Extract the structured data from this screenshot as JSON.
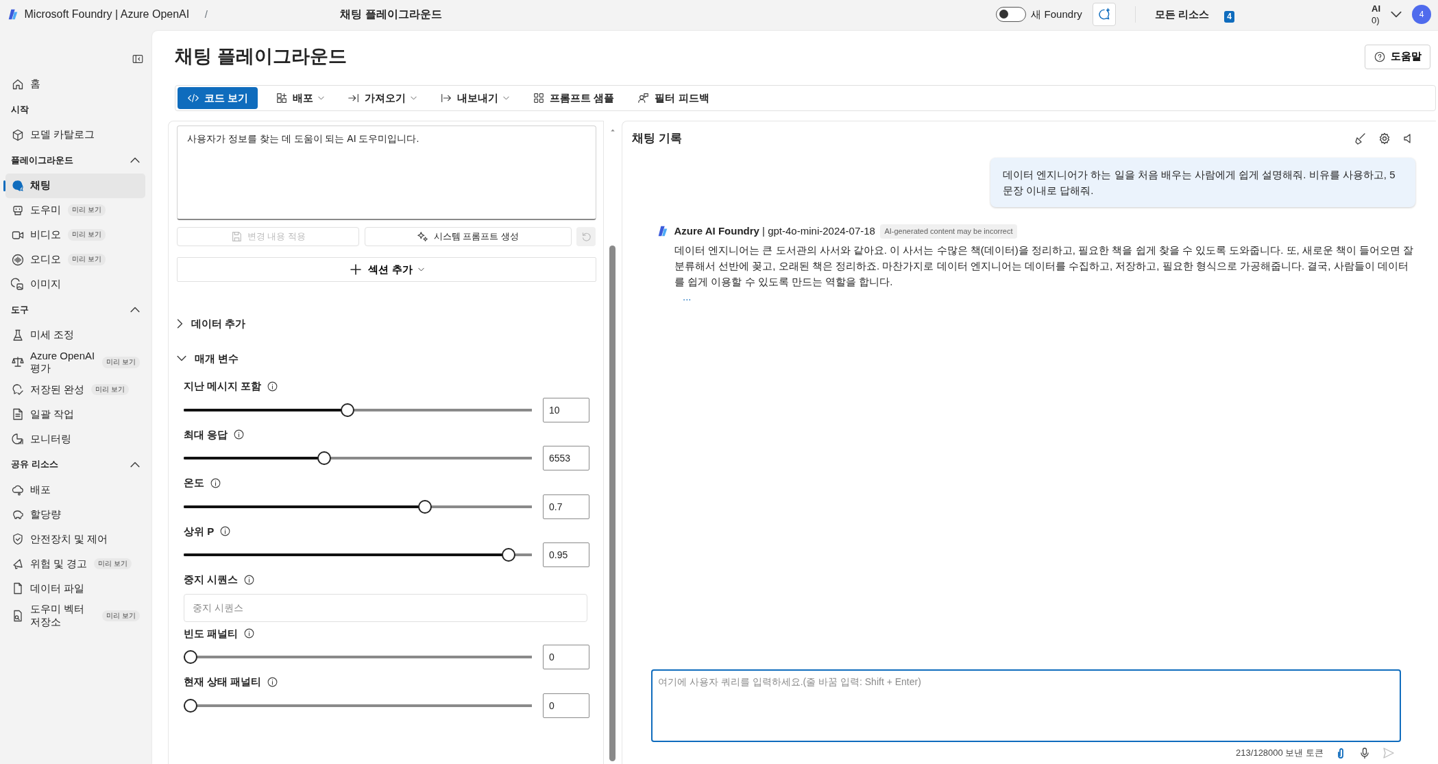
{
  "top_bar": {
    "brand": "Microsoft Foundry | Azure OpenAI",
    "separator": "/",
    "page": "채팅 플레이그라운드",
    "toggle": {
      "label": "새 Foundry",
      "on": false
    },
    "resources": "모든 리소스",
    "resources_badge": "4",
    "account_line_1": "AI",
    "account_line_2": "0)",
    "avatar": "4"
  },
  "sidebar": {
    "top_items": [
      {
        "label": "홈",
        "selected": false
      }
    ],
    "sections": [
      {
        "title": "시작",
        "items": [
          {
            "label": "모델 카탈로그",
            "selected": false
          }
        ]
      },
      {
        "title": "플레이그라운드",
        "expanded": true,
        "items": [
          {
            "label": "채팅",
            "selected": true
          },
          {
            "label": "도우미",
            "selected": false,
            "badge": "미리 보기"
          },
          {
            "label": "비디오",
            "selected": false,
            "badge": "미리 보기"
          },
          {
            "label": "오디오",
            "selected": false,
            "badge": "미리 보기"
          },
          {
            "label": "이미지",
            "selected": false
          }
        ]
      },
      {
        "title": "도구",
        "expanded": true,
        "items": [
          {
            "label": "미세 조정",
            "selected": false
          },
          {
            "label": "Azure OpenAI 평가",
            "selected": false,
            "badge": "미리 보기"
          },
          {
            "label": "저장된 완성",
            "selected": false,
            "badge": "미리 보기"
          },
          {
            "label": "일괄 작업",
            "selected": false
          },
          {
            "label": "모니터링",
            "selected": false
          }
        ]
      },
      {
        "title": "공유 리소스",
        "expanded": true,
        "items": [
          {
            "label": "배포",
            "selected": false
          },
          {
            "label": "할당량",
            "selected": false
          },
          {
            "label": "안전장치 및 제어",
            "selected": false
          },
          {
            "label": "위험 및 경고",
            "selected": false,
            "badge": "미리 보기"
          },
          {
            "label": "데이터 파일",
            "selected": false
          },
          {
            "label": "도우미 벡터 저장소",
            "selected": false,
            "badge": "미리 보기"
          }
        ]
      }
    ]
  },
  "page_title": "채팅 플레이그라운드",
  "help": "도움말",
  "toolbar": [
    {
      "label": "코드 보기",
      "selected": true,
      "dropdown": false
    },
    {
      "label": "배포",
      "selected": false,
      "dropdown": true
    },
    {
      "label": "가져오기",
      "selected": false,
      "dropdown": true
    },
    {
      "label": "내보내기",
      "selected": false,
      "dropdown": true
    },
    {
      "label": "프롬프트 샘플",
      "selected": false,
      "dropdown": false
    },
    {
      "label": "필터 피드백",
      "selected": false,
      "dropdown": false
    }
  ],
  "system_prompt": {
    "value": "사용자가 정보를 찾는 데 도움이 되는 AI 도우미입니다.",
    "apply_button": {
      "label": "변경 내용 적용",
      "disabled": true
    },
    "generate_button": "시스템 프롬프트 생성",
    "reset_disabled": true
  },
  "add_section": "섹션 추가",
  "collapsibles": [
    {
      "label": "데이터 추가",
      "expanded": false
    },
    {
      "label": "매개 변수",
      "expanded": true
    }
  ],
  "parameters": [
    {
      "kind": "slider",
      "label": "지난 메시지 포함",
      "level": 0.47,
      "value": "10"
    },
    {
      "kind": "slider",
      "label": "최대 응답",
      "level": 0.4,
      "value": "6553"
    },
    {
      "kind": "slider",
      "label": "온도",
      "level": 0.7,
      "value": "0.7"
    },
    {
      "kind": "slider",
      "label": "상위 P",
      "level": 0.95,
      "value": "0.95"
    },
    {
      "kind": "text",
      "label": "중지 시퀀스",
      "placeholder": "중지 시퀀스"
    },
    {
      "kind": "slider",
      "label": "빈도 패널티",
      "level": 0,
      "value": "0"
    },
    {
      "kind": "slider",
      "label": "현재 상태 패널티",
      "level": 0,
      "value": "0"
    }
  ],
  "chat": {
    "title": "채팅 기록",
    "messages": [
      {
        "kind": "user",
        "text": "데이터 엔지니어가 하는 일을 처음 배우는 사람에게 쉽게 설명해줘. 비유를 사용하고, 5문장 이내로 답해줘."
      },
      {
        "kind": "assistant",
        "sender": "**Azure AI Foundry** | gpt-4o-mini-2024-07-18",
        "tag": "AI-generated content may be incorrect",
        "text": "데이터 엔지니어는 큰 도서관의 사서와 같아요. 이 사서는 수많은 책(데이터)을 정리하고, 필요한 책을 쉽게 찾을 수 있도록 도와줍니다. 또, 새로운 책이 들어오면 잘 분류해서 선반에 꽂고, 오래된 책은 정리하죠. 마찬가지로 데이터 엔지니어는 데이터를 수집하고, 저장하고, 필요한 형식으로 가공해줍니다. 결국, 사람들이 데이터를 쉽게 이용할 수 있도록 만드는 역할을 합니다.",
        "more": "..."
      }
    ],
    "input": {
      "placeholder": "여기에 사용자 쿼리를 입력하세요.(줄 바꿈 입력: Shift + Enter)"
    },
    "token_count": "213/128000 보낸 토큰"
  }
}
